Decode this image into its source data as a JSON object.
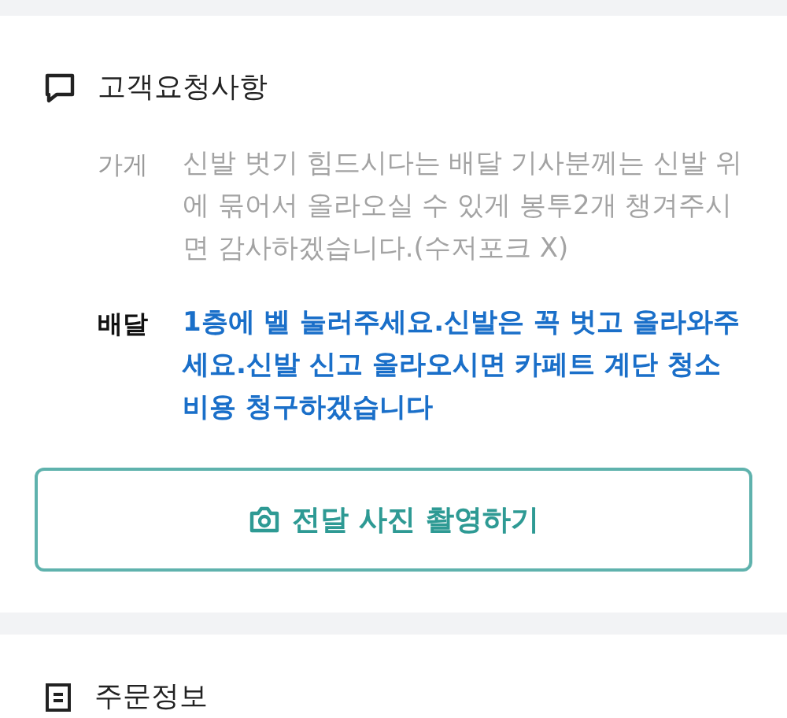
{
  "request_section": {
    "title": "고객요청사항",
    "requests": [
      {
        "kind": "store",
        "label": "가게",
        "text": "신발 벗기 힘드시다는 배달 기사분께는 신발 위에 묶어서 올라오실 수 있게 봉투2개 챙겨주시면 감사하겠습니다.(수저포크 X)"
      },
      {
        "kind": "delivery",
        "label": "배달",
        "text": "1층에 벨 눌러주세요.신발은 꼭 벗고 올라와주세요.신발 신고 올라오시면 카페트 계단 청소 비용 청구하겠습니다"
      }
    ],
    "photo_button": "전달 사진 촬영하기"
  },
  "order_section": {
    "title": "주문정보"
  }
}
